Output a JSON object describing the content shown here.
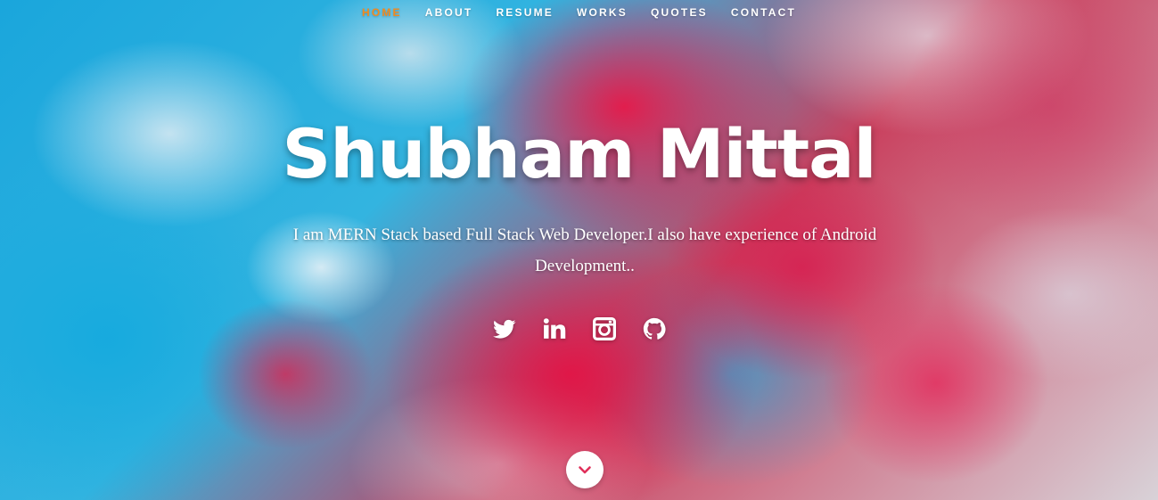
{
  "nav": {
    "items": [
      {
        "label": "HOME",
        "active": true
      },
      {
        "label": "ABOUT",
        "active": false
      },
      {
        "label": "RESUME",
        "active": false
      },
      {
        "label": "WORKS",
        "active": false
      },
      {
        "label": "QUOTES",
        "active": false
      },
      {
        "label": "CONTACT",
        "active": false
      }
    ],
    "active_color": "#f28a1e"
  },
  "hero": {
    "title": "Shubham Mittal",
    "subtitle": "I am MERN Stack based Full Stack Web Developer.I also have experience of Android Development..",
    "social": [
      {
        "icon": "twitter-icon"
      },
      {
        "icon": "linkedin-icon"
      },
      {
        "icon": "instagram-icon"
      },
      {
        "icon": "github-icon"
      }
    ],
    "scroll_icon": "chevron-down-icon"
  },
  "colors": {
    "text": "#ffffff",
    "accent": "#f28a1e",
    "chevron": "#e0305a"
  }
}
